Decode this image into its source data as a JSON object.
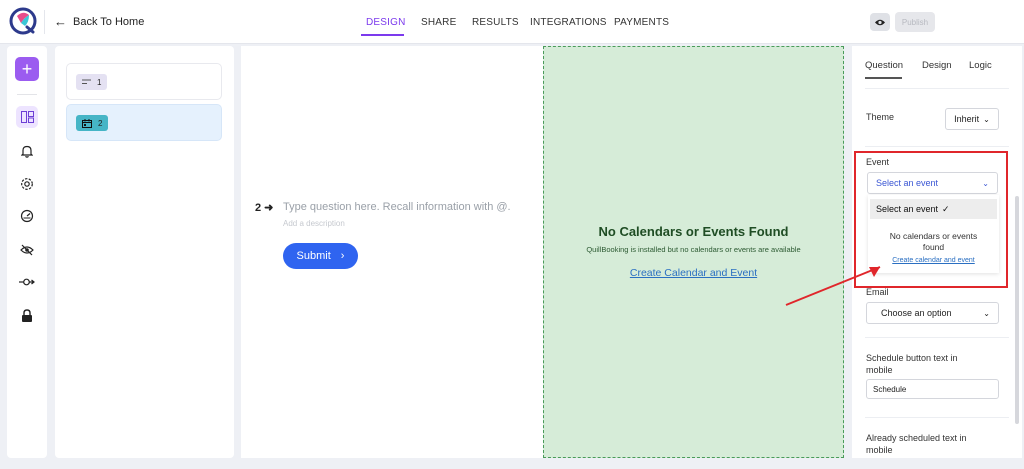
{
  "header": {
    "back_label": "Back To Home",
    "nav": [
      {
        "label": "DESIGN"
      },
      {
        "label": "SHARE"
      },
      {
        "label": "RESULTS"
      },
      {
        "label": "INTEGRATIONS"
      },
      {
        "label": "PAYMENTS"
      }
    ],
    "publish_label": "Publish"
  },
  "blocks": [
    {
      "index": "1"
    },
    {
      "index": "2"
    }
  ],
  "canvas": {
    "question_number": "2",
    "question_placeholder": "Type question here. Recall information with @.",
    "description_placeholder": "Add a description",
    "submit_label": "Submit"
  },
  "preview": {
    "title": "No Calendars or Events Found",
    "subtitle": "QuillBooking is installed but no calendars or events are available",
    "link": "Create Calendar and Event"
  },
  "settings": {
    "tabs": [
      {
        "label": "Question"
      },
      {
        "label": "Design"
      },
      {
        "label": "Logic"
      }
    ],
    "theme_label": "Theme",
    "theme_value": "Inherit",
    "event_label": "Event",
    "event_value": "Select an event",
    "event_dropdown": {
      "option": "Select an event",
      "empty_text_1": "No calendars or events",
      "empty_text_2": "found",
      "link": "Create calendar and event"
    },
    "email_label": "Email",
    "email_value": "Choose an option",
    "schedule_label_1": "Schedule button text in",
    "schedule_label_2": "mobile",
    "schedule_value": "Schedule",
    "already_label_1": "Already scheduled text in",
    "already_label_2": "mobile"
  },
  "colors": {
    "accent": "#7c3aed",
    "primary_button": "#2f64f0",
    "preview_bg": "#d6ecd8",
    "highlight": "#e0262b"
  }
}
